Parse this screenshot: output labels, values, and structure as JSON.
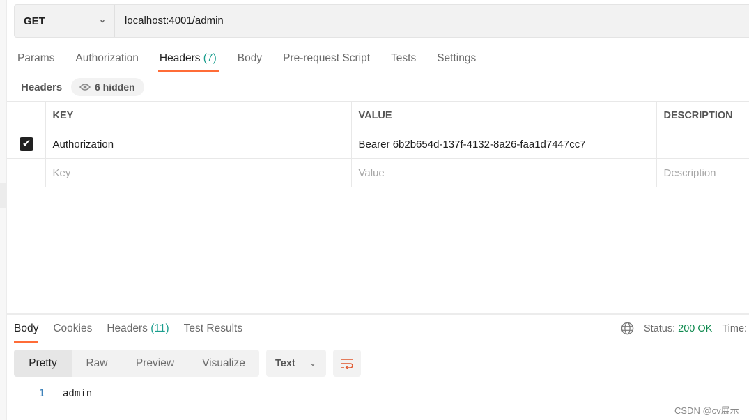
{
  "request": {
    "method": "GET",
    "url": "localhost:4001/admin"
  },
  "request_tabs": [
    {
      "label": "Params"
    },
    {
      "label": "Authorization"
    },
    {
      "label": "Headers",
      "count": "(7)",
      "active": true
    },
    {
      "label": "Body"
    },
    {
      "label": "Pre-request Script"
    },
    {
      "label": "Tests"
    },
    {
      "label": "Settings"
    }
  ],
  "headers_section": {
    "title": "Headers",
    "hidden_label": "6 hidden"
  },
  "headers_table": {
    "columns": [
      "KEY",
      "VALUE",
      "DESCRIPTION"
    ],
    "rows": [
      {
        "checked": true,
        "key": "Authorization",
        "value": "Bearer 6b2b654d-137f-4132-8a26-faa1d7447cc7",
        "description": ""
      }
    ],
    "placeholders": {
      "key": "Key",
      "value": "Value",
      "description": "Description"
    }
  },
  "response_tabs": [
    {
      "label": "Body",
      "active": true
    },
    {
      "label": "Cookies"
    },
    {
      "label": "Headers",
      "count": "(11)"
    },
    {
      "label": "Test Results"
    }
  ],
  "response_status": {
    "label": "Status:",
    "value": "200 OK",
    "time_label": "Time:"
  },
  "view_modes": [
    "Pretty",
    "Raw",
    "Preview",
    "Visualize"
  ],
  "format": "Text",
  "body_lines": [
    {
      "num": "1",
      "text": "admin"
    }
  ],
  "watermark": "CSDN @cv展示",
  "colors": {
    "accent": "#ff6c37",
    "count": "#1b9e8e",
    "status_ok": "#0f8a4f"
  }
}
